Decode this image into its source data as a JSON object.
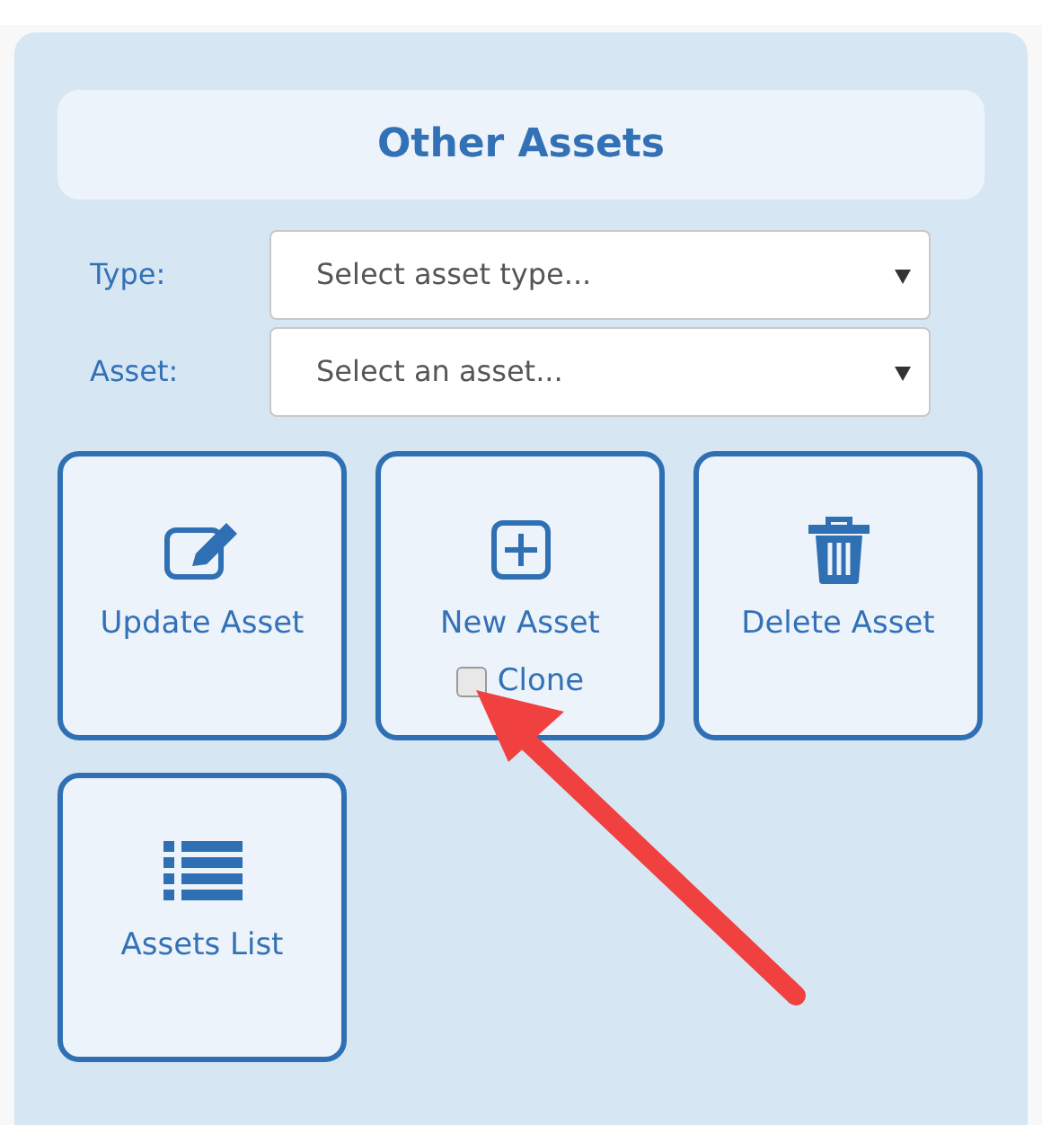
{
  "panel": {
    "title": "Other Assets"
  },
  "fields": [
    {
      "label": "Type:",
      "placeholder": "Select asset type..."
    },
    {
      "label": "Asset:",
      "placeholder": "Select an asset..."
    }
  ],
  "tiles": [
    {
      "label": "Update Asset",
      "kind": "edit"
    },
    {
      "label": "New Asset",
      "kind": "add",
      "option": {
        "label": "Clone",
        "checked": false
      }
    },
    {
      "label": "Delete Asset",
      "kind": "delete"
    },
    {
      "label": "Assets List",
      "kind": "list"
    }
  ]
}
